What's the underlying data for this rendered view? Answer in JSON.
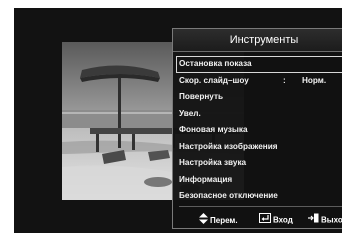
{
  "panel": {
    "title": "Инструменты",
    "items": [
      {
        "label": "Остановка показа",
        "selected": true
      },
      {
        "label": "Скор. слайд–шоу",
        "separator": ":",
        "value": "Норм."
      },
      {
        "label": "Повернуть"
      },
      {
        "label": "Увел."
      },
      {
        "label": "Фоновая музыка"
      },
      {
        "label": "Настройка изображения"
      },
      {
        "label": "Настройка звука"
      },
      {
        "label": "Информация"
      },
      {
        "label": "Безопасное отключение"
      }
    ]
  },
  "footer": {
    "move_label": "Перем.",
    "enter_label": "Вход",
    "exit_label": "Выход",
    "move_icon": "up-down-arrows-icon",
    "enter_icon": "enter-icon",
    "exit_icon": "exit-icon"
  },
  "colors": {
    "screen_background": "#121212",
    "panel_background": "#121212",
    "text": "#ffffff",
    "selection_border": "#d8d8d8"
  }
}
